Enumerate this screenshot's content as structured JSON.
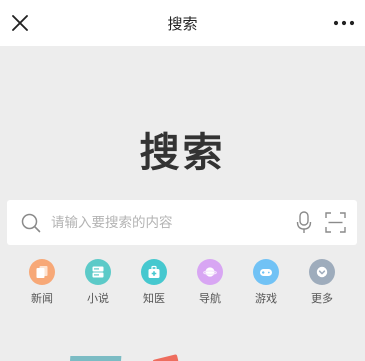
{
  "nav": {
    "title": "搜索"
  },
  "hero": {
    "logo_text": "搜索"
  },
  "search": {
    "placeholder": "请输入要搜索的内容",
    "value": ""
  },
  "entries": [
    {
      "label": "新闻",
      "color": "#f7a877",
      "icon": "document-icon"
    },
    {
      "label": "小说",
      "color": "#5ccac8",
      "icon": "book-icon"
    },
    {
      "label": "知医",
      "color": "#46c8cf",
      "icon": "medical-kit-icon"
    },
    {
      "label": "导航",
      "color": "#d8a6f3",
      "icon": "planet-icon"
    },
    {
      "label": "游戏",
      "color": "#71c2f5",
      "icon": "gamepad-icon"
    },
    {
      "label": "更多",
      "color": "#9eacbc",
      "icon": "chevron-down-icon"
    }
  ]
}
